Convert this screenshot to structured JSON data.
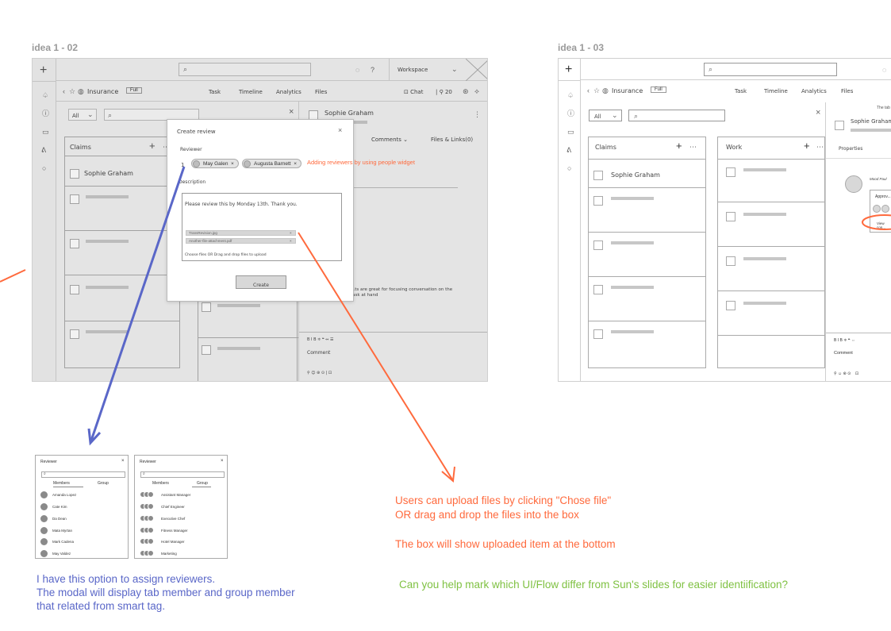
{
  "frames": {
    "left_label": "idea 1 - 02",
    "right_label": "idea 1 - 03"
  },
  "left": {
    "workspace": "Workspace",
    "breadcrumb": "Insurance",
    "full": "Full",
    "tabs": [
      "Task",
      "Timeline",
      "Analytics",
      "Files"
    ],
    "chat": "Chat",
    "count": "20",
    "filter_all": "All",
    "claims": "Claims",
    "card_name": "Sophie Graham",
    "detail_name": "Sophie Graham",
    "comments_tab": "Comments",
    "files_links_tab": "Files & Links(0)",
    "comment_hint": "...ts are great for focusing conversation on the task at hand",
    "comment_label": "Comment",
    "format_bar": "B  I  B  ≑  ❝  ⇔  ☰",
    "modal": {
      "title": "Create review",
      "close": "×",
      "reviewer_label": "Reviewer",
      "chips": [
        "May Galen",
        "Augusta Barnett"
      ],
      "annotation": "Adding reviewers by using people widget",
      "description_label": "Description",
      "description_text": "Please review this by Monday 13th. Thank you.",
      "files": [
        "TransRevision.jpg",
        "Another-file-attachment.pdf"
      ],
      "upload_hint": "Choose files  OR  Drag and drop files to upload",
      "create_button": "Create"
    }
  },
  "right": {
    "breadcrumb": "Insurance",
    "full": "Full",
    "tabs": [
      "Task",
      "Timeline",
      "Analytics",
      "Files"
    ],
    "filter_all": "All",
    "columns": [
      "Claims",
      "Work"
    ],
    "card_name": "Sophie Graham",
    "detail_name": "Sophie Graham",
    "the_tab": "The tab",
    "properties": "Properties",
    "person": "Mood Paul",
    "approval": "Approv...",
    "view_more": "View con...",
    "comment_label": "Comment",
    "format_bar": "B  I  B  ≑  ❝  ⇔"
  },
  "reviewer_modals": [
    {
      "title": "Reviewer",
      "col_members": "Members",
      "col_group": "Group",
      "rows": [
        "Amanda Lopez",
        "Cate Kim",
        "Da Dean",
        "Mata Myrtan",
        "Mark Cadena",
        "May Valdez"
      ]
    },
    {
      "title": "Reviewer",
      "col_members": "Members",
      "col_group": "Group",
      "rows": [
        "Assistant Manager",
        "Chief Engineer",
        "Executive Chef",
        "Fitness Manager",
        "Hotel Manager",
        "Marketing"
      ]
    }
  ],
  "notes": {
    "orange_1": "Users can upload files by clicking \"Chose file\"",
    "orange_2": "OR drag and drop the files into the box",
    "orange_3": "The box will show uploaded item at the bottom",
    "blue_1": "I have this option to assign reviewers.",
    "blue_2": "The modal will display tab member and group member",
    "blue_3": "that related from smart tag.",
    "green": "Can you help mark which UI/Flow differ from Sun's slides for easier identiification?"
  },
  "colors": {
    "orange": "#ff6a3d",
    "blue": "#5a67c8",
    "green": "#7fc142"
  }
}
